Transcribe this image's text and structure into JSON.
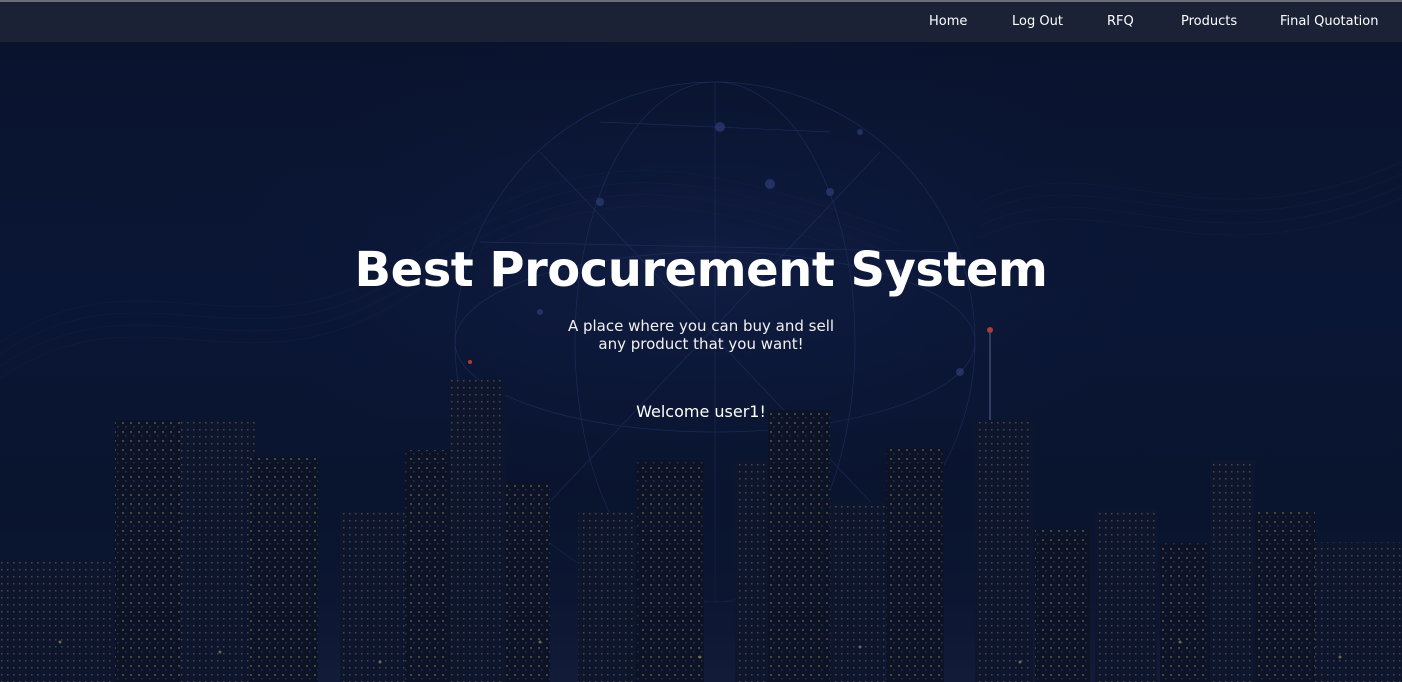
{
  "nav": {
    "items": [
      {
        "label": "Home"
      },
      {
        "label": "Log Out"
      },
      {
        "label": "RFQ"
      },
      {
        "label": "Products"
      },
      {
        "label": "Final Quotation"
      }
    ]
  },
  "hero": {
    "title": "Best Procurement System",
    "subtitle_line1": "A place where you can buy and sell",
    "subtitle_line2": "any product that you want!",
    "welcome": "Welcome user1!"
  },
  "colors": {
    "navbar_bg": "#1b2236",
    "background": "#0a1430",
    "text": "#ffffff"
  }
}
